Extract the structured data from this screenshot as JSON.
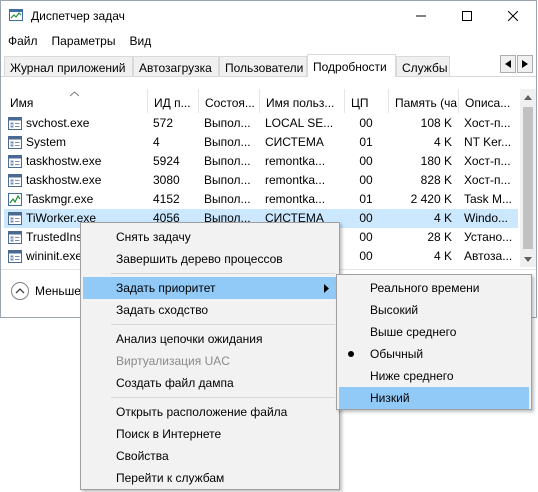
{
  "window": {
    "title": "Диспетчер задач"
  },
  "menu": [
    "Файл",
    "Параметры",
    "Вид"
  ],
  "tabs": [
    {
      "label": "Журнал приложений",
      "active": false
    },
    {
      "label": "Автозагрузка",
      "active": false
    },
    {
      "label": "Пользователи",
      "active": false
    },
    {
      "label": "Подробности",
      "active": true
    },
    {
      "label": "Службы",
      "active": false
    }
  ],
  "columns": [
    "Имя",
    "ИД п...",
    "Состоя...",
    "Имя польз...",
    "ЦП",
    "Память (ча...",
    "Описа..."
  ],
  "rows": [
    {
      "name": "svchost.exe",
      "pid": "572",
      "state": "Выпол...",
      "user": "LOCAL SE...",
      "cpu": "00",
      "mem": "108 K",
      "desc": "Хост-п...",
      "icon": "service-icon",
      "selected": false
    },
    {
      "name": "System",
      "pid": "4",
      "state": "Выпол...",
      "user": "СИСТЕМА",
      "cpu": "01",
      "mem": "4 K",
      "desc": "NT Ker...",
      "icon": "service-icon",
      "selected": false
    },
    {
      "name": "taskhostw.exe",
      "pid": "5924",
      "state": "Выпол...",
      "user": "remontka...",
      "cpu": "00",
      "mem": "180 K",
      "desc": "Хост-п...",
      "icon": "service-icon",
      "selected": false
    },
    {
      "name": "taskhostw.exe",
      "pid": "3080",
      "state": "Выпол...",
      "user": "remontka...",
      "cpu": "00",
      "mem": "828 K",
      "desc": "Хост-п...",
      "icon": "service-icon",
      "selected": false
    },
    {
      "name": "Taskmgr.exe",
      "pid": "4152",
      "state": "Выпол...",
      "user": "remontka...",
      "cpu": "01",
      "mem": "2 420 K",
      "desc": "Task M...",
      "icon": "task-manager-icon",
      "selected": false
    },
    {
      "name": "TiWorker.exe",
      "pid": "4056",
      "state": "Выпол...",
      "user": "СИСТЕМА",
      "cpu": "00",
      "mem": "4 K",
      "desc": "Windo...",
      "icon": "service-icon",
      "selected": true
    },
    {
      "name": "TrustedInst",
      "pid": "",
      "state": "",
      "user": "",
      "cpu": "00",
      "mem": "28 K",
      "desc": "Устано...",
      "icon": "service-icon",
      "selected": false
    },
    {
      "name": "wininit.exe",
      "pid": "",
      "state": "",
      "user": "",
      "cpu": "00",
      "mem": "4 K",
      "desc": "Автоза...",
      "icon": "service-icon",
      "selected": false
    }
  ],
  "status": {
    "less_label": "Меньше"
  },
  "context_menu": {
    "items": [
      {
        "label": "Снять задачу"
      },
      {
        "label": "Завершить дерево процессов"
      },
      {
        "label": "Задать приоритет",
        "highlighted": true,
        "submenu": true
      },
      {
        "label": "Задать сходство"
      },
      {
        "label": "Анализ цепочки ожидания"
      },
      {
        "label": "Виртуализация UAC",
        "disabled": true
      },
      {
        "label": "Создать файл дампа"
      },
      {
        "label": "Открыть расположение файла"
      },
      {
        "label": "Поиск в Интернете"
      },
      {
        "label": "Свойства"
      },
      {
        "label": "Перейти к службам"
      }
    ]
  },
  "priority_menu": {
    "items": [
      {
        "label": "Реального времени"
      },
      {
        "label": "Высокий"
      },
      {
        "label": "Выше среднего"
      },
      {
        "label": "Обычный",
        "checked": true
      },
      {
        "label": "Ниже среднего"
      },
      {
        "label": "Низкий",
        "highlighted": true
      }
    ]
  },
  "colors": {
    "selection": "#cce8ff",
    "menu_highlight": "#91c9f7",
    "menu_bg": "#f2f2f2"
  }
}
